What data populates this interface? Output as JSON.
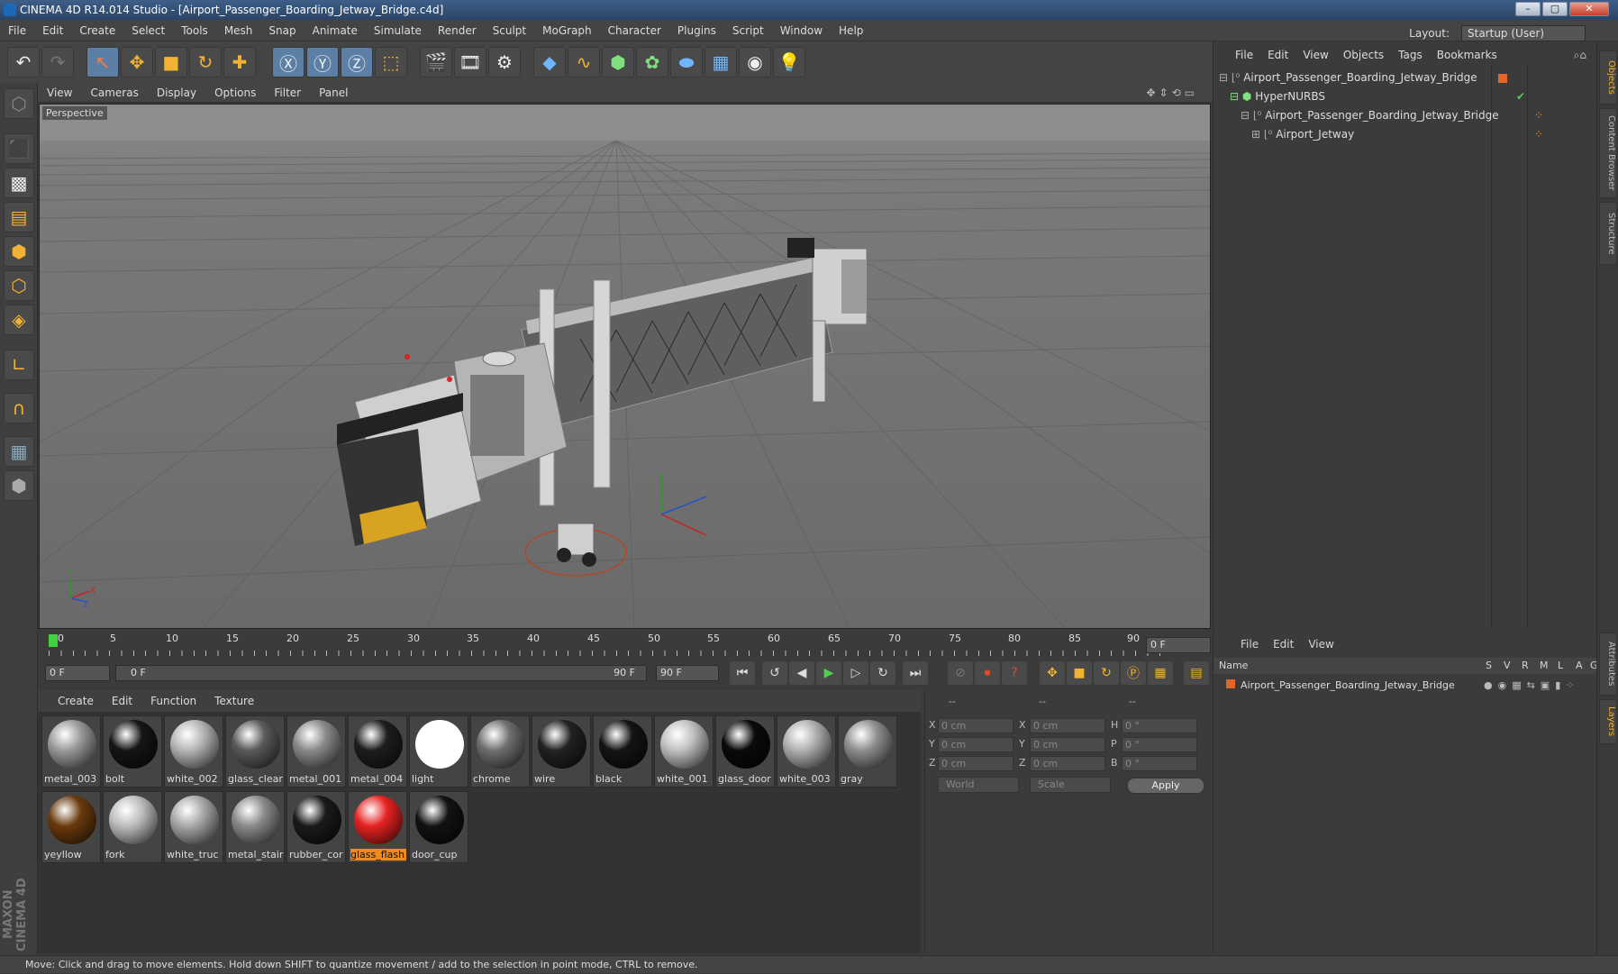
{
  "window": {
    "title": "CINEMA 4D R14.014 Studio - [Airport_Passenger_Boarding_Jetway_Bridge.c4d]",
    "minimize": "–",
    "maximize": "▢",
    "close": "✕"
  },
  "menubar": {
    "items": [
      "File",
      "Edit",
      "Create",
      "Select",
      "Tools",
      "Mesh",
      "Snap",
      "Animate",
      "Simulate",
      "Render",
      "Sculpt",
      "MoGraph",
      "Character",
      "Plugins",
      "Script",
      "Window",
      "Help"
    ],
    "layout_label": "Layout:",
    "layout_value": "Startup (User)"
  },
  "viewport": {
    "menu": [
      "View",
      "Cameras",
      "Display",
      "Options",
      "Filter",
      "Panel"
    ],
    "label": "Perspective",
    "axis_labels": {
      "y": "Y",
      "x": "X",
      "z": "Z"
    }
  },
  "timeline": {
    "ticks": [
      "0",
      "5",
      "10",
      "15",
      "20",
      "25",
      "30",
      "35",
      "40",
      "45",
      "50",
      "55",
      "60",
      "65",
      "70",
      "75",
      "80",
      "85",
      "90"
    ],
    "current_frame": "0 F",
    "start_frame": "0 F",
    "range_start": "0 F",
    "range_end": "90 F",
    "end_frame": "90 F"
  },
  "materials": {
    "menu": [
      "Create",
      "Edit",
      "Function",
      "Texture"
    ],
    "items": [
      {
        "name": "metal_003",
        "color": "#9a9a9a"
      },
      {
        "name": "bolt",
        "color": "#151515"
      },
      {
        "name": "white_002",
        "color": "#b5b5b5"
      },
      {
        "name": "glass_clear",
        "color": "#5a5a5a"
      },
      {
        "name": "metal_001",
        "color": "#8a8a8a"
      },
      {
        "name": "metal_004",
        "color": "#1e1e1e"
      },
      {
        "name": "light",
        "color": "#ffffff"
      },
      {
        "name": "chrome",
        "color": "#6f6f6f"
      },
      {
        "name": "wire",
        "color": "#222222"
      },
      {
        "name": "black",
        "color": "#141414"
      },
      {
        "name": "white_001",
        "color": "#c0c0c0"
      },
      {
        "name": "glass_door",
        "color": "#0a0a0a"
      },
      {
        "name": "white_003",
        "color": "#b0b0b0"
      },
      {
        "name": "gray",
        "color": "#8e8e8e"
      },
      {
        "name": "yeyllow",
        "color": "#6a3a0e"
      },
      {
        "name": "fork",
        "color": "#bdbdbd"
      },
      {
        "name": "white_truc",
        "color": "#a8a8a8"
      },
      {
        "name": "metal_stair",
        "color": "#8a8a8a"
      },
      {
        "name": "rubber_cor",
        "color": "#1a1a1a"
      },
      {
        "name": "glass_flash",
        "color": "#e62222"
      },
      {
        "name": "door_cup",
        "color": "#121212"
      }
    ],
    "selected_index": 19
  },
  "coordinates": {
    "headers": [
      "--",
      "--",
      "--"
    ],
    "rows": [
      {
        "axis1": "X",
        "val1": "0 cm",
        "axis2": "X",
        "val2": "0 cm",
        "axis3": "H",
        "val3": "0 °"
      },
      {
        "axis1": "Y",
        "val1": "0 cm",
        "axis2": "Y",
        "val2": "0 cm",
        "axis3": "P",
        "val3": "0 °"
      },
      {
        "axis1": "Z",
        "val1": "0 cm",
        "axis2": "Z",
        "val2": "0 cm",
        "axis3": "B",
        "val3": "0 °"
      }
    ],
    "mode": "World",
    "scale": "Scale",
    "apply": "Apply"
  },
  "object_manager": {
    "menu": [
      "File",
      "Edit",
      "View",
      "Objects",
      "Tags",
      "Bookmarks"
    ],
    "objects": [
      {
        "name": "Airport_Passenger_Boarding_Jetway_Bridge",
        "indent": 0
      },
      {
        "name": "HyperNURBS",
        "indent": 1
      },
      {
        "name": "Airport_Passenger_Boarding_Jetway_Bridge",
        "indent": 2
      },
      {
        "name": "Airport_Jetway",
        "indent": 3
      }
    ]
  },
  "layer_manager": {
    "menu": [
      "File",
      "Edit",
      "View"
    ],
    "name_header": "Name",
    "col_headers": [
      "S",
      "V",
      "R",
      "M",
      "L",
      "A",
      "G"
    ],
    "layer": "Airport_Passenger_Boarding_Jetway_Bridge"
  },
  "side_tabs": [
    "Objects",
    "Content Browser",
    "Structure",
    "Attributes",
    "Layers"
  ],
  "status": "Move: Click and drag to move elements. Hold down SHIFT to quantize movement / add to the selection in point mode, CTRL to remove.",
  "brand": "MAXON CINEMA 4D"
}
